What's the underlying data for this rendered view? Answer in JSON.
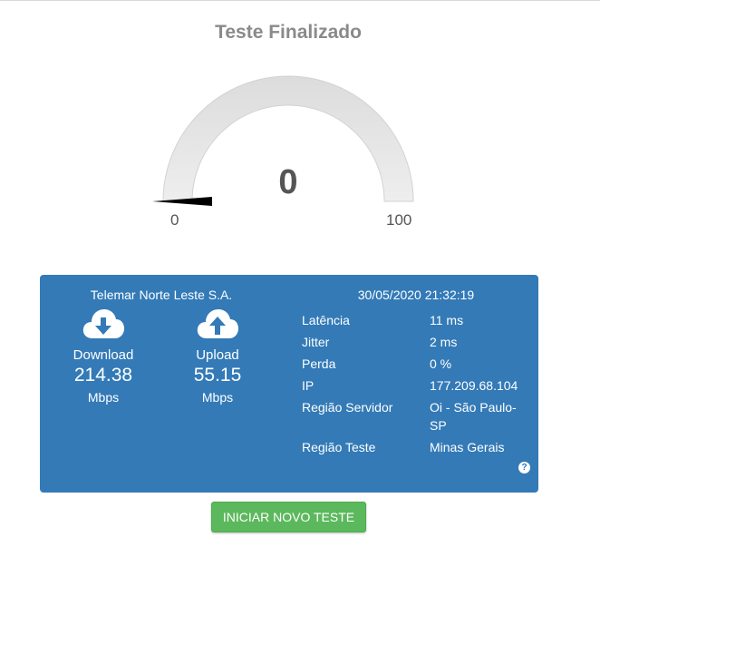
{
  "title": "Teste Finalizado",
  "gauge": {
    "value": "0",
    "min": "0",
    "max": "100",
    "level": 0
  },
  "result": {
    "isp": "Telemar Norte Leste S.A.",
    "datetime": "30/05/2020 21:32:19",
    "download": {
      "label": "Download",
      "value": "214.38",
      "unit": "Mbps",
      "icon": "cloud-download-icon"
    },
    "upload": {
      "label": "Upload",
      "value": "55.15",
      "unit": "Mbps",
      "icon": "cloud-upload-icon"
    },
    "details": [
      {
        "label": "Latência",
        "value": "11 ms"
      },
      {
        "label": "Jitter",
        "value": "2 ms"
      },
      {
        "label": "Perda",
        "value": "0 %"
      },
      {
        "label": "IP",
        "value": "177.209.68.104"
      },
      {
        "label": "Região Servidor",
        "value": "Oi - São Paulo-SP"
      },
      {
        "label": "Região Teste",
        "value": "Minas Gerais"
      }
    ],
    "help_icon": "question-circle-icon"
  },
  "button": {
    "label": "INICIAR NOVO TESTE"
  },
  "colors": {
    "card": "#337ab7",
    "button": "#5cb85c",
    "gauge_track": "#e6e6e6",
    "title": "#8a8a8a"
  }
}
